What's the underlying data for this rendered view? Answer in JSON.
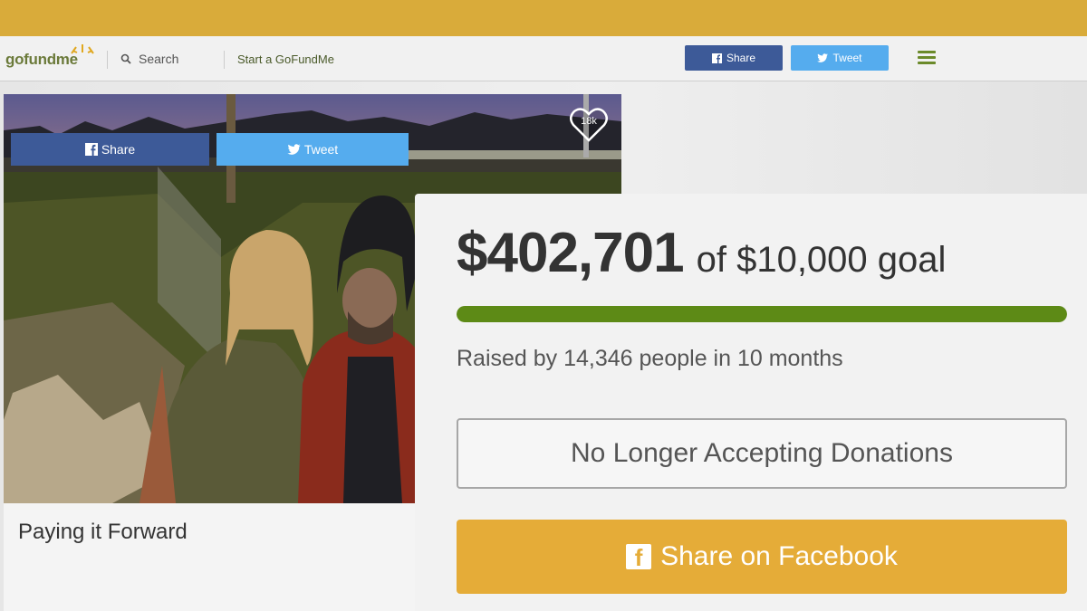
{
  "header": {
    "logo": "gofundme",
    "search_label": "Search",
    "start_label": "Start a GoFundMe",
    "share_label": "Share",
    "tweet_label": "Tweet"
  },
  "photo": {
    "likes": "18k"
  },
  "campaign": {
    "title": "Paying it Forward",
    "share_label": "Share",
    "tweet_label": "Tweet"
  },
  "donation": {
    "raised": "$402,701",
    "goal_text": "of $10,000 goal",
    "progress_percent": 100,
    "raised_by": "Raised by 14,346 people in 10 months",
    "status": "No Longer Accepting Donations",
    "share_facebook": "Share on Facebook"
  },
  "colors": {
    "accent": "#d9ab3a",
    "facebook": "#3d5a98",
    "twitter": "#55acee",
    "progress": "#5d8a16",
    "share_button": "#e5ac38"
  }
}
